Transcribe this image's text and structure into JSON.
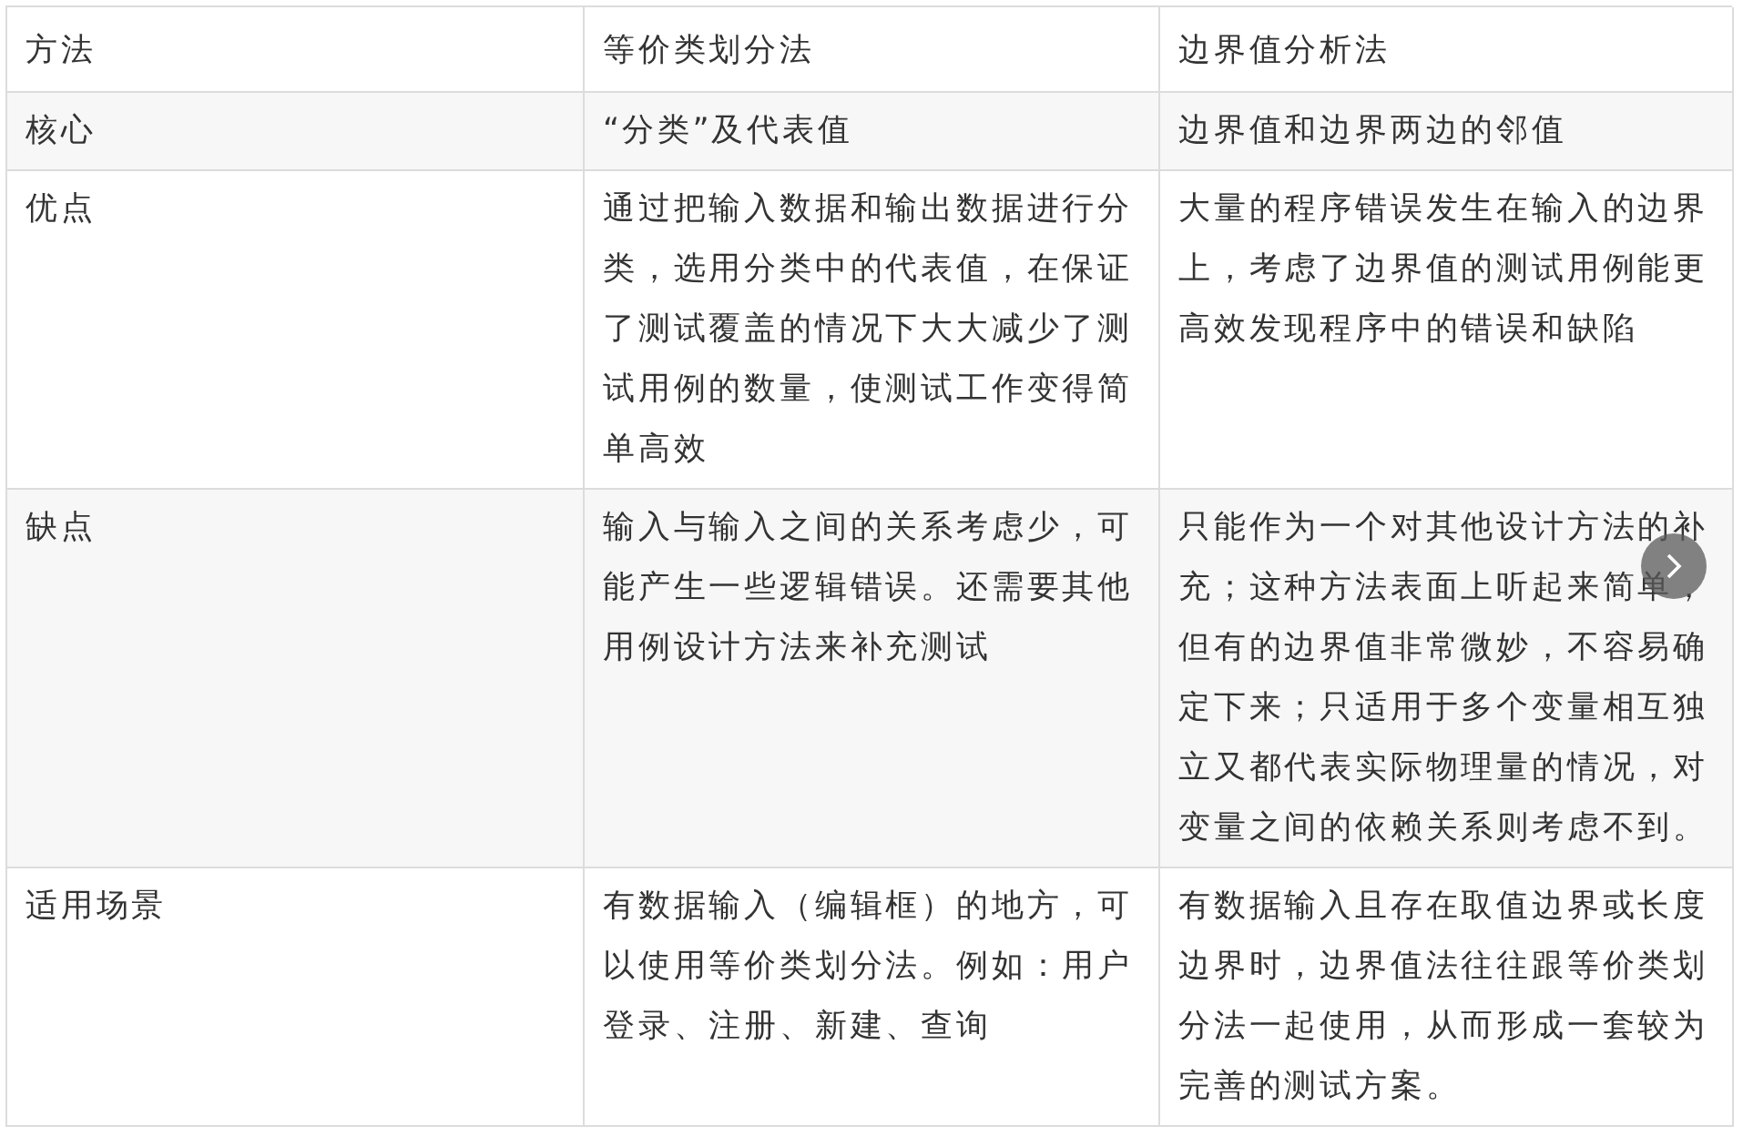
{
  "table": {
    "columns": [
      "方法",
      "等价类划分法",
      "边界值分析法"
    ],
    "rows": [
      {
        "cells": [
          "核心",
          "“分类”及代表值",
          "边界值和边界两边的邻值"
        ]
      },
      {
        "cells": [
          "优点",
          "通过把输入数据和输出数据进行分类，选用分类中的代表值，在保证了测试覆盖的情况下大大减少了测试用例的数量，使测试工作变得简单高效",
          "大量的程序错误发生在输入的边界上，考虑了边界值的测试用例能更高效发现程序中的错误和缺陷"
        ]
      },
      {
        "cells": [
          "缺点",
          "输入与输入之间的关系考虑少，可能产生一些逻辑错误。还需要其他用例设计方法来补充测试",
          "只能作为一个对其他设计方法的补充；这种方法表面上听起来简单，但有的边界值非常微妙，不容易确定下来；只适用于多个变量相互独立又都代表实际物理量的情况，对变量之间的依赖关系则考虑不到。"
        ]
      },
      {
        "cells": [
          "适用场景",
          "有数据输入（编辑框）的地方，可以使用等价类划分法。例如：用户登录、注册、新建、查询",
          "有数据输入且存在取值边界或长度边界时，边界值法往往跟等价类划分法一起使用，从而形成一套较为完善的测试方案。"
        ]
      }
    ]
  }
}
